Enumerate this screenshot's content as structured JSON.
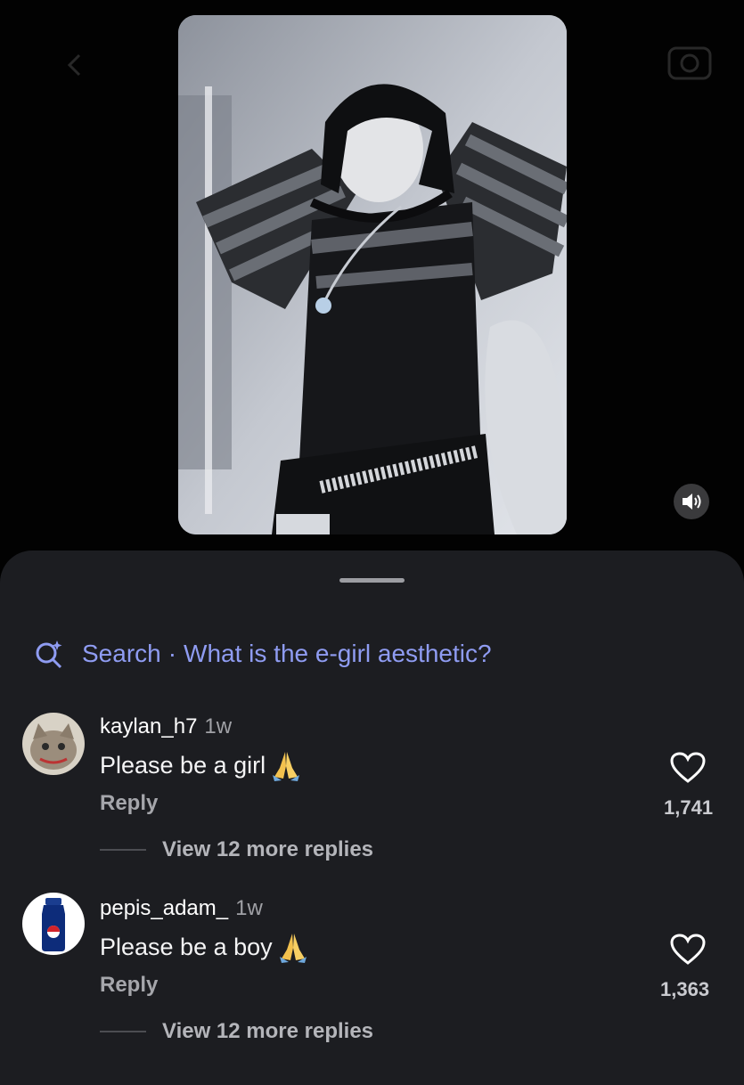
{
  "top_bar": {
    "back_icon": "chevron-left-icon",
    "camera_icon": "camera-icon"
  },
  "video": {
    "sound_icon": "speaker-on-icon"
  },
  "search": {
    "icon": "sparkle-search-icon",
    "label": "Search",
    "separator": "·",
    "query": "What is the e-girl aesthetic?"
  },
  "comments": [
    {
      "username": "kaylan_h7",
      "time": "1w",
      "text": "Please be a girl",
      "emoji": "folded-hands-icon",
      "reply_label": "Reply",
      "likes": "1,741",
      "view_replies": "View 12 more replies"
    },
    {
      "username": "pepis_adam_",
      "time": "1w",
      "text": "Please be a boy",
      "emoji": "folded-hands-icon",
      "reply_label": "Reply",
      "likes": "1,363",
      "view_replies": "View 12 more replies"
    }
  ],
  "colors": {
    "sheet_bg": "#1c1d21",
    "search_accent": "#8f9cf2",
    "secondary_text": "#a5a6ab"
  }
}
